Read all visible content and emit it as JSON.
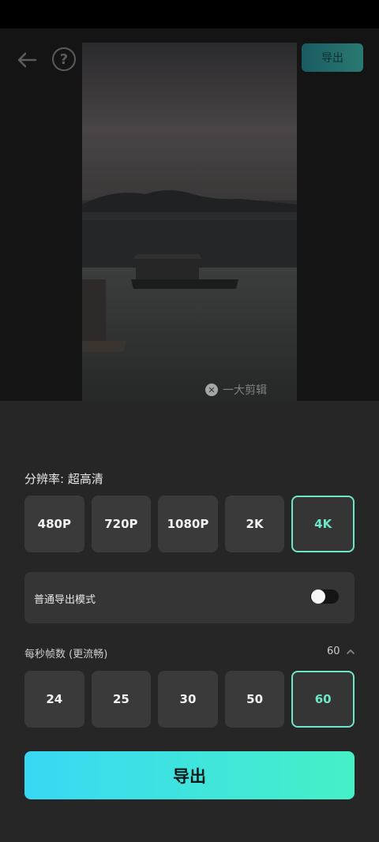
{
  "header": {
    "export_label": "导出",
    "help_symbol": "?"
  },
  "preview": {
    "watermark_text": "一大剪辑"
  },
  "resolution": {
    "label": "分辨率: 超高清",
    "options": [
      "480P",
      "720P",
      "1080P",
      "2K",
      "4K"
    ],
    "selected": "4K"
  },
  "mode": {
    "label": "普通导出模式",
    "toggle_on": false
  },
  "fps": {
    "label": "每秒帧数 (更流畅)",
    "current": "60",
    "options": [
      "24",
      "25",
      "30",
      "50",
      "60"
    ],
    "selected": "60"
  },
  "footer": {
    "export_label": "导出"
  },
  "colors": {
    "accent": "#6ee6c9",
    "gradient_start": "#38d8f4",
    "gradient_end": "#46f0c6"
  }
}
